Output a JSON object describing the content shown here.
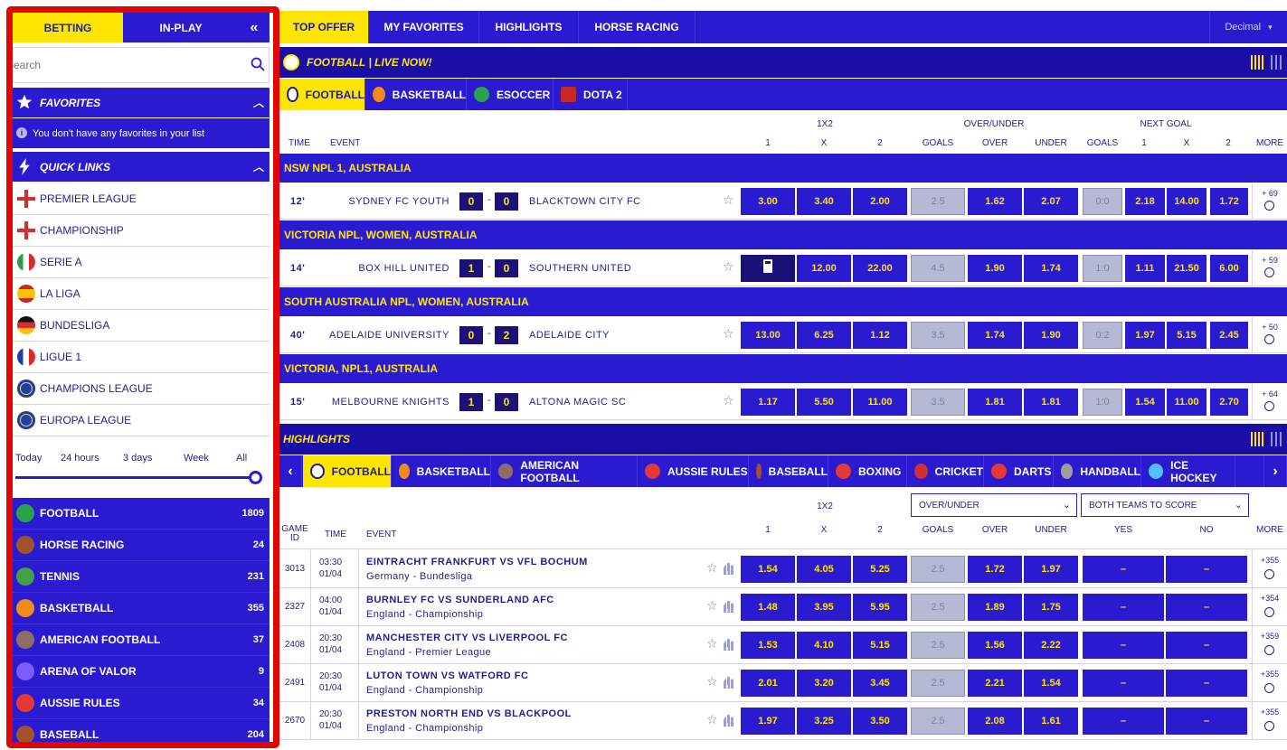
{
  "sidebar": {
    "tab_betting": "BETTING",
    "tab_inplay": "IN-PLAY",
    "search_placeholder": "Search",
    "favorites_title": "FAVORITES",
    "favorites_empty": "You don't have any favorites in your list",
    "quicklinks_title": "QUICK LINKS",
    "quick_links": [
      {
        "label": "PREMIER LEAGUE",
        "icon": "england-flag-icon"
      },
      {
        "label": "CHAMPIONSHIP",
        "icon": "england-flag-icon"
      },
      {
        "label": "SERIE A",
        "icon": "italy-flag-icon"
      },
      {
        "label": "LA LIGA",
        "icon": "spain-flag-icon"
      },
      {
        "label": "BUNDESLIGA",
        "icon": "germany-flag-icon"
      },
      {
        "label": "LIGUE 1",
        "icon": "france-flag-icon"
      },
      {
        "label": "CHAMPIONS LEAGUE",
        "icon": "europe-flag-icon"
      },
      {
        "label": "EUROPA LEAGUE",
        "icon": "europe-flag-icon"
      }
    ],
    "time_filters": [
      "Today",
      "24 hours",
      "3 days",
      "Week",
      "All"
    ],
    "time_filter_value": 1.0,
    "sports": [
      {
        "label": "FOOTBALL",
        "count": "1809"
      },
      {
        "label": "HORSE RACING",
        "count": "24"
      },
      {
        "label": "TENNIS",
        "count": "231"
      },
      {
        "label": "BASKETBALL",
        "count": "355"
      },
      {
        "label": "AMERICAN FOOTBALL",
        "count": "37"
      },
      {
        "label": "ARENA OF VALOR",
        "count": "9"
      },
      {
        "label": "AUSSIE RULES",
        "count": "34"
      },
      {
        "label": "BASEBALL",
        "count": "204"
      }
    ]
  },
  "topnav": {
    "items": [
      "TOP OFFER",
      "MY FAVORITES",
      "HIGHLIGHTS",
      "HORSE RACING"
    ],
    "odds_format": "Decimal"
  },
  "live": {
    "title": "FOOTBALL | LIVE NOW!",
    "tabs": [
      "FOOTBALL",
      "BASKETBALL",
      "ESOCCER",
      "DOTA 2"
    ],
    "headers": {
      "time": "TIME",
      "event": "EVENT",
      "group_1x2": "1X2",
      "group_ou": "OVER/UNDER",
      "group_ng": "NEXT GOAL",
      "c1": "1",
      "cx": "X",
      "c2": "2",
      "goals": "GOALS",
      "over": "OVER",
      "under": "UNDER",
      "ng_goals": "GOALS",
      "ng1": "1",
      "ngx": "X",
      "ng2": "2",
      "more": "MORE"
    },
    "matches": [
      {
        "league": "NSW NPL 1, AUSTRALIA",
        "time": "12'",
        "home": "SYDNEY FC YOUTH",
        "hs": "0",
        "as": "0",
        "away": "BLACKTOWN CITY FC",
        "o1": "3.00",
        "ox": "3.40",
        "o2": "2.00",
        "goals": "2.5",
        "over": "1.62",
        "under": "2.07",
        "ng": "0:0",
        "n1": "2.18",
        "nx": "14.00",
        "n2": "1.72",
        "more": "+ 69"
      },
      {
        "league": "VICTORIA NPL, WOMEN, AUSTRALIA",
        "time": "14'",
        "home": "BOX HILL UNITED",
        "hs": "1",
        "as": "0",
        "away": "SOUTHERN UNITED",
        "o1": "",
        "ox": "12.00",
        "o2": "22.00",
        "goals": "4.5",
        "over": "1.90",
        "under": "1.74",
        "ng": "1:0",
        "n1": "1.11",
        "nx": "21.50",
        "n2": "6.00",
        "more": "+ 59"
      },
      {
        "league": "SOUTH AUSTRALIA NPL, WOMEN, AUSTRALIA",
        "time": "40'",
        "home": "ADELAIDE UNIVERSITY",
        "hs": "0",
        "as": "2",
        "away": "ADELAIDE CITY",
        "o1": "13.00",
        "ox": "6.25",
        "o2": "1.12",
        "goals": "3.5",
        "over": "1.74",
        "under": "1.90",
        "ng": "0:2",
        "n1": "1.97",
        "nx": "5.15",
        "n2": "2.45",
        "more": "+ 50"
      },
      {
        "league": "VICTORIA, NPL1, AUSTRALIA",
        "time": "15'",
        "home": "MELBOURNE KNIGHTS",
        "hs": "1",
        "as": "0",
        "away": "ALTONA MAGIC SC",
        "o1": "1.17",
        "ox": "5.50",
        "o2": "11.00",
        "goals": "3.5",
        "over": "1.81",
        "under": "1.81",
        "ng": "1:0",
        "n1": "1.54",
        "nx": "11.00",
        "n2": "2.70",
        "more": "+ 64"
      }
    ]
  },
  "highlights": {
    "title": "HIGHLIGHTS",
    "tabs": [
      "FOOTBALL",
      "BASKETBALL",
      "AMERICAN FOOTBALL",
      "AUSSIE RULES",
      "BASEBALL",
      "BOXING",
      "CRICKET",
      "DARTS",
      "HANDBALL",
      "ICE HOCKEY"
    ],
    "select_ou": "OVER/UNDER",
    "select_btts": "BOTH TEAMS TO SCORE",
    "headers": {
      "game_id": "GAME ID",
      "time": "TIME",
      "event": "EVENT",
      "group_1x2": "1X2",
      "c1": "1",
      "cx": "X",
      "c2": "2",
      "goals": "GOALS",
      "over": "OVER",
      "under": "UNDER",
      "yes": "YES",
      "no": "NO",
      "more": "MORE"
    },
    "rows": [
      {
        "id": "3013",
        "time": "03:30",
        "date": "01/04",
        "event": "EINTRACHT FRANKFURT VS VFL BOCHUM",
        "sub": "Germany - Bundesliga",
        "o1": "1.54",
        "ox": "4.05",
        "o2": "5.25",
        "goals": "2.5",
        "over": "1.72",
        "under": "1.97",
        "yes": "–",
        "no": "–",
        "more": "+355"
      },
      {
        "id": "2327",
        "time": "04:00",
        "date": "01/04",
        "event": "BURNLEY FC VS SUNDERLAND AFC",
        "sub": "England - Championship",
        "o1": "1.48",
        "ox": "3.95",
        "o2": "5.95",
        "goals": "2.5",
        "over": "1.89",
        "under": "1.75",
        "yes": "–",
        "no": "–",
        "more": "+354"
      },
      {
        "id": "2408",
        "time": "20:30",
        "date": "01/04",
        "event": "MANCHESTER CITY VS LIVERPOOL FC",
        "sub": "England - Premier League",
        "o1": "1.53",
        "ox": "4.10",
        "o2": "5.15",
        "goals": "2.5",
        "over": "1.56",
        "under": "2.22",
        "yes": "–",
        "no": "–",
        "more": "+359"
      },
      {
        "id": "2491",
        "time": "20:30",
        "date": "01/04",
        "event": "LUTON TOWN VS WATFORD FC",
        "sub": "England - Championship",
        "o1": "2.01",
        "ox": "3.20",
        "o2": "3.45",
        "goals": "2.5",
        "over": "2.21",
        "under": "1.54",
        "yes": "–",
        "no": "–",
        "more": "+355"
      },
      {
        "id": "2670",
        "time": "20:30",
        "date": "01/04",
        "event": "PRESTON NORTH END VS BLACKPOOL",
        "sub": "England - Championship",
        "o1": "1.97",
        "ox": "3.25",
        "o2": "3.50",
        "goals": "2.5",
        "over": "2.08",
        "under": "1.61",
        "yes": "–",
        "no": "–",
        "more": "+355"
      }
    ]
  },
  "colors": {
    "primary": "#2a1bd1",
    "dark": "#1a0ea6",
    "accent": "#ffe600",
    "frame": "#e10600"
  }
}
